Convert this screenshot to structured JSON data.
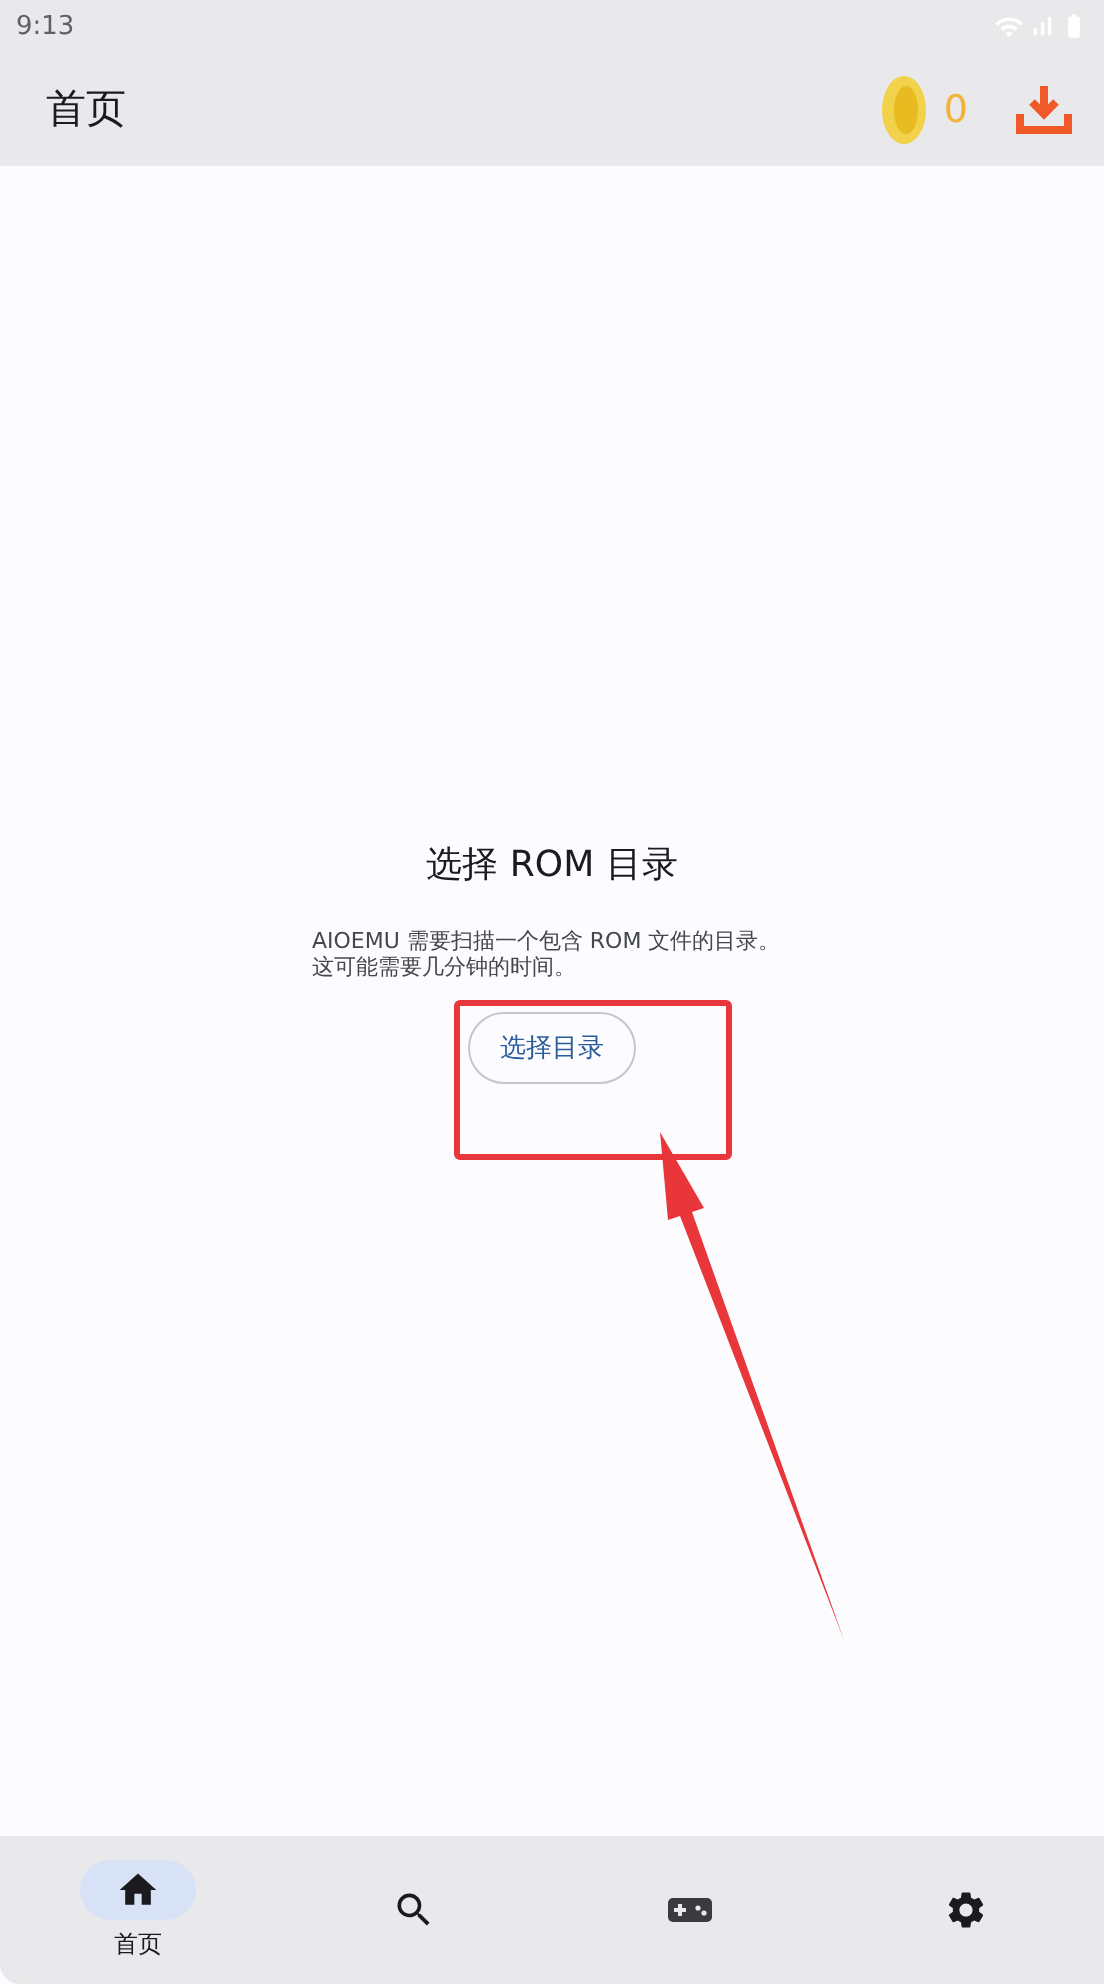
{
  "status_bar": {
    "time": "9:13"
  },
  "app_bar": {
    "title": "首页",
    "coins": "0"
  },
  "empty_state": {
    "title": "选择 ROM 目录",
    "message": [
      "AIOEMU 需要扫描一个包含 ROM 文件的目录。",
      "这可能需要几分钟的时间。"
    ],
    "button": "选择目录"
  },
  "bottom_nav": [
    {
      "kind": "home",
      "label": "首页",
      "selected": true
    },
    {
      "kind": "search",
      "selected": false
    },
    {
      "kind": "games",
      "selected": false
    },
    {
      "kind": "settings",
      "selected": false
    }
  ]
}
